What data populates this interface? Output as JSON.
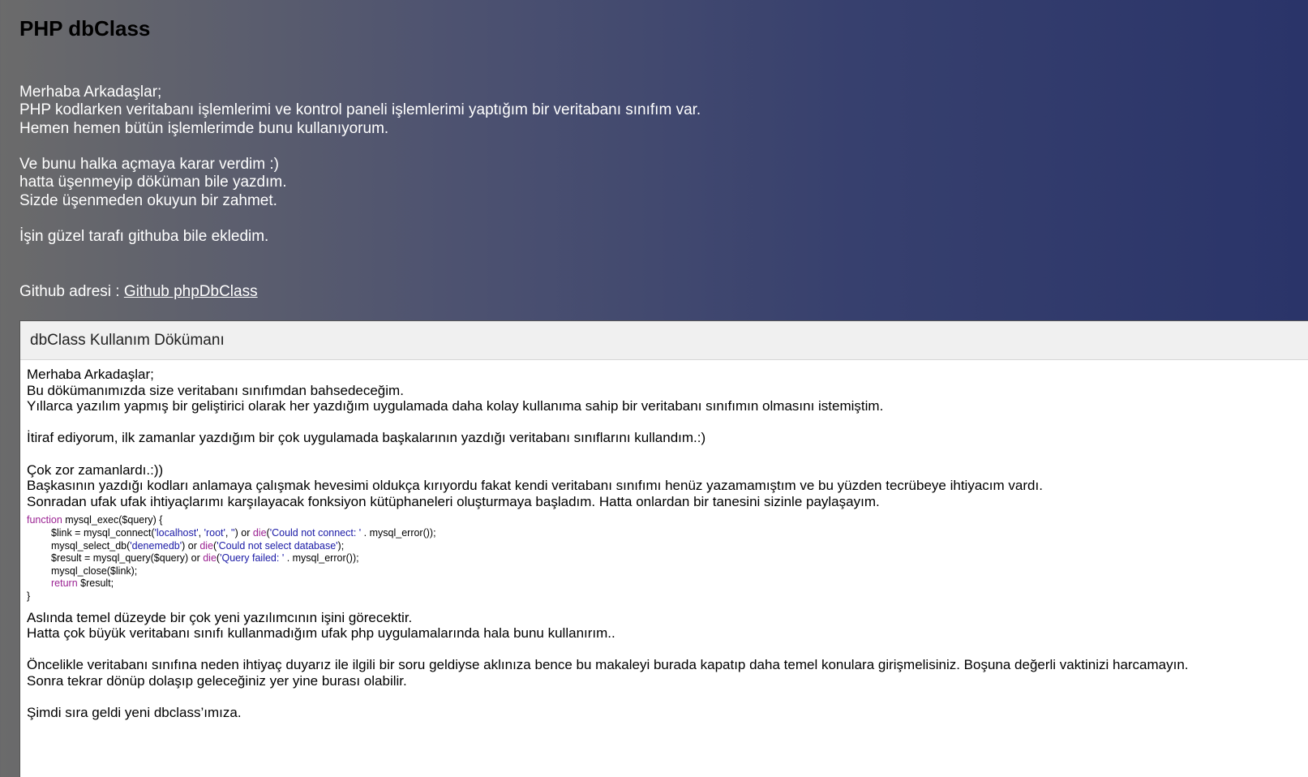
{
  "page": {
    "title": "PHP dbClass"
  },
  "intro": {
    "lines": [
      "Merhaba Arkadaşlar;",
      "PHP kodlarken veritabanı işlemlerimi ve kontrol paneli işlemlerimi yaptığım bir veritabanı sınıfım var.",
      "Hemen hemen bütün işlemlerimde bunu kullanıyorum.",
      "",
      "Ve bunu halka açmaya karar verdim :)",
      "hatta üşenmeyip döküman bile yazdım.",
      "Sizde üşenmeden okuyun bir zahmet.",
      "",
      "İşin güzel tarafı githuba bile ekledim."
    ]
  },
  "github": {
    "label": "Github adresi : ",
    "link_text": "Github phpDbClass "
  },
  "doc": {
    "header": "dbClass Kullanım Dökümanı",
    "paragraphs_before_code": [
      "Merhaba Arkadaşlar;",
      "Bu dökümanımızda size veritabanı sınıfımdan bahsedeceğim.",
      "Yıllarca yazılım yapmış bir geliştirici olarak her yazdığım uygulamada daha kolay kullanıma sahip bir veritabanı sınıfımın olmasını istemiştim.",
      "",
      "İtiraf ediyorum, ilk zamanlar yazdığım bir çok uygulamada başkalarının yazdığı veritabanı sınıflarını kullandım.:)",
      "",
      "Çok zor zamanlardı.:))",
      "Başkasının yazdığı kodları anlamaya çalışmak hevesimi oldukça kırıyordu fakat kendi veritabanı sınıfımı henüz yazamamıştım ve bu yüzden tecrübeye ihtiyacım vardı.",
      "Sonradan ufak ufak ihtiyaçlarımı karşılayacak fonksiyon kütüphaneleri oluşturmaya başladım. Hatta onlardan bir tanesini sizinle paylaşayım."
    ],
    "code": {
      "l1_kw": "function",
      "l1_rest": " mysql_exec($query) {",
      "l2_a": "$link = mysql_connect(",
      "l2_s1": "'localhost'",
      "l2_b": ", ",
      "l2_s2": "'root'",
      "l2_c": ", ",
      "l2_s3": "''",
      "l2_d": ") or ",
      "l2_die": "die",
      "l2_e": "(",
      "l2_s4": "'Could not connect: '",
      "l2_f": " . mysql_error());",
      "l3_a": "mysql_select_db(",
      "l3_s1": "'denemedb'",
      "l3_b": ") or ",
      "l3_die": "die",
      "l3_c": "(",
      "l3_s2": "'Could not select database'",
      "l3_d": ");",
      "l4_a": "$result = mysql_query($query) or ",
      "l4_die": "die",
      "l4_b": "(",
      "l4_s1": "'Query failed: '",
      "l4_c": " . mysql_error());",
      "l5": "mysql_close($link);",
      "l6_kw": "return",
      "l6_rest": " $result;",
      "l7": "}"
    },
    "paragraphs_after_code": [
      "Aslında temel düzeyde bir çok yeni yazılımcının işini görecektir.",
      "Hatta çok büyük veritabanı sınıfı kullanmadığım ufak php uygulamalarında hala bunu kullanırım..",
      "",
      "Öncelikle veritabanı sınıfına neden ihtiyaç duyarız ile ilgili bir soru geldiyse aklınıza bence bu makaleyi burada kapatıp daha temel konulara girişmelisiniz. Boşuna değerli vaktinizi harcamayın.",
      "Sonra tekrar dönüp dolaşıp geleceğiniz yer yine burası olabilir.",
      "",
      "Şimdi sıra geldi yeni dbclass’ımıza."
    ]
  },
  "colors": {
    "keyword": "#9b2393",
    "string": "#1a1aa6",
    "title": "#000000",
    "intro_text": "#ffffff"
  }
}
